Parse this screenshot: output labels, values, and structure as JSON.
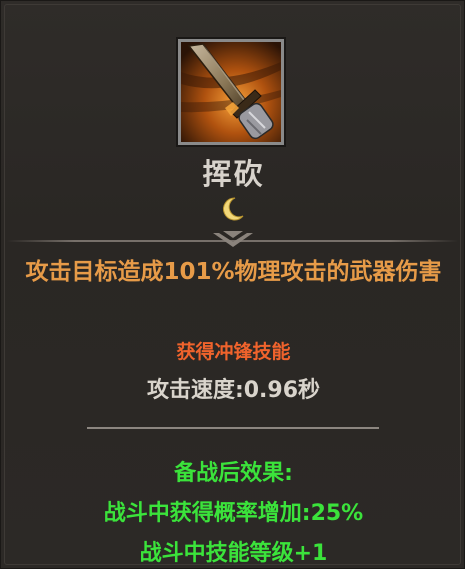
{
  "skill": {
    "name": "挥砍",
    "icon": "sword-slash-icon",
    "tier_icon": "crescent-moon-icon",
    "description": "攻击目标造成101%物理攻击的武器伤害",
    "charge_text": "获得冲锋技能",
    "attack_speed": "攻击速度:0.96秒"
  },
  "reserve_effects": {
    "title": "备战后效果:",
    "lines": [
      "战斗中获得概率增加:25%",
      "战斗中技能等级+1"
    ]
  },
  "colors": {
    "description": "#e79b48",
    "charge": "#f0632c",
    "reserve": "#3be33b",
    "name": "#d8d3cc"
  }
}
